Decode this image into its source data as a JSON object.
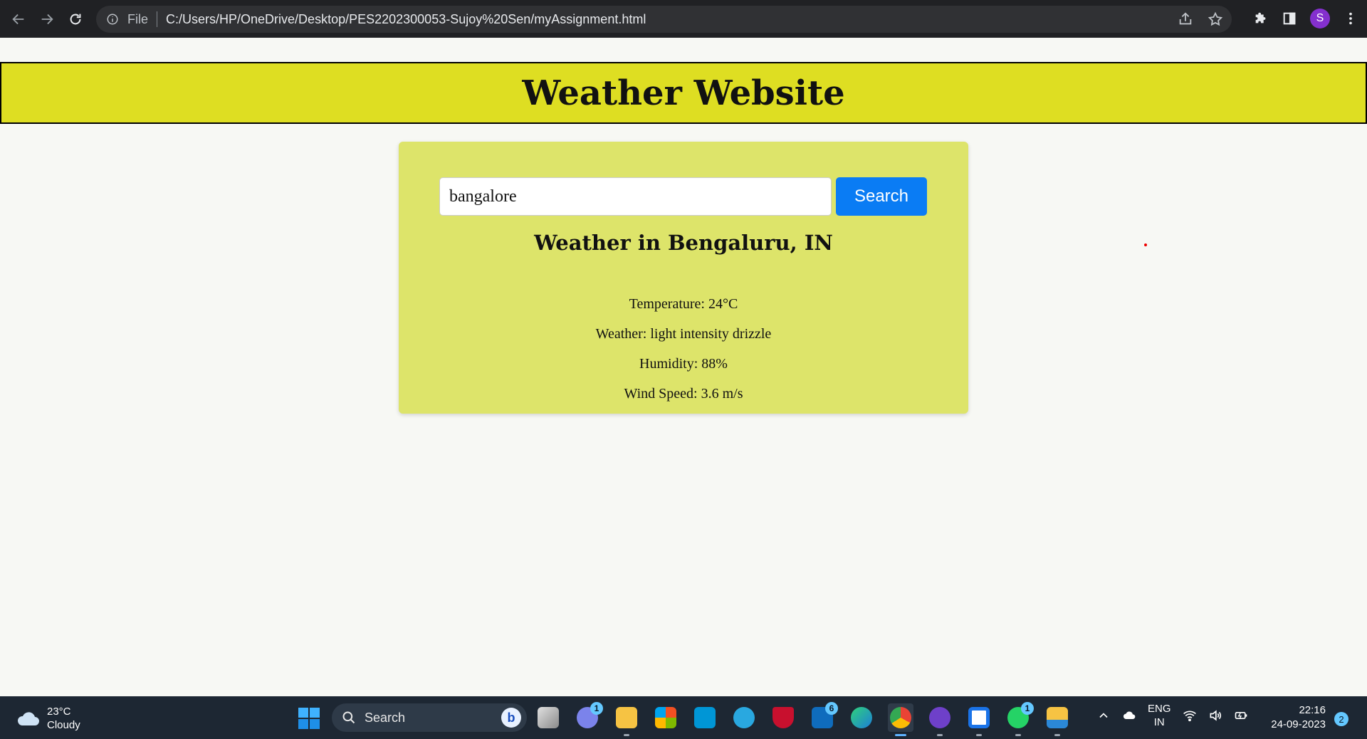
{
  "browser": {
    "file_label": "File",
    "url": "C:/Users/HP/OneDrive/Desktop/PES2202300053-Sujoy%20Sen/myAssignment.html",
    "profile_initial": "S"
  },
  "page": {
    "title": "Weather Website",
    "search": {
      "value": "bangalore",
      "button_label": "Search"
    },
    "result": {
      "heading": "Weather in Bengaluru, IN",
      "temperature": "Temperature: 24°C",
      "weather": "Weather: light intensity drizzle",
      "humidity": "Humidity: 88%",
      "wind_speed": "Wind Speed: 3.6 m/s"
    }
  },
  "taskbar": {
    "weather_temp": "23°C",
    "weather_desc": "Cloudy",
    "search_label": "Search",
    "apps": [
      {
        "name": "task-view",
        "badge": ""
      },
      {
        "name": "teams-chat",
        "badge": "1"
      },
      {
        "name": "file-explorer",
        "badge": ""
      },
      {
        "name": "microsoft-store",
        "badge": ""
      },
      {
        "name": "myhp",
        "badge": ""
      },
      {
        "name": "help",
        "badge": ""
      },
      {
        "name": "mcafee",
        "badge": ""
      },
      {
        "name": "mail",
        "badge": "6"
      },
      {
        "name": "edge",
        "badge": ""
      },
      {
        "name": "chrome",
        "badge": ""
      },
      {
        "name": "github-desktop",
        "badge": ""
      },
      {
        "name": "app-window",
        "badge": ""
      },
      {
        "name": "whatsapp",
        "badge": "1"
      },
      {
        "name": "file-manager",
        "badge": ""
      }
    ],
    "lang_top": "ENG",
    "lang_bottom": "IN",
    "time": "22:16",
    "date": "24-09-2023",
    "notifications": "2"
  },
  "colors": {
    "header_bg": "#dede22",
    "card_bg": "#dde46a",
    "button_bg": "#0a7cf4"
  }
}
